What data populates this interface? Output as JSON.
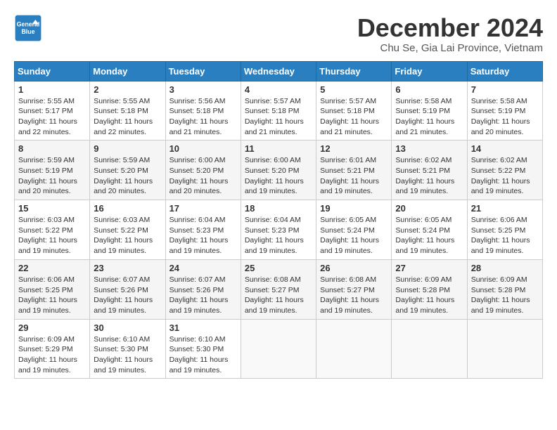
{
  "logo": {
    "line1": "General",
    "line2": "Blue"
  },
  "title": "December 2024",
  "subtitle": "Chu Se, Gia Lai Province, Vietnam",
  "days_of_week": [
    "Sunday",
    "Monday",
    "Tuesday",
    "Wednesday",
    "Thursday",
    "Friday",
    "Saturday"
  ],
  "weeks": [
    [
      {
        "num": "1",
        "sunrise": "5:55 AM",
        "sunset": "5:17 PM",
        "daylight": "11 hours and 22 minutes."
      },
      {
        "num": "2",
        "sunrise": "5:55 AM",
        "sunset": "5:18 PM",
        "daylight": "11 hours and 22 minutes."
      },
      {
        "num": "3",
        "sunrise": "5:56 AM",
        "sunset": "5:18 PM",
        "daylight": "11 hours and 21 minutes."
      },
      {
        "num": "4",
        "sunrise": "5:57 AM",
        "sunset": "5:18 PM",
        "daylight": "11 hours and 21 minutes."
      },
      {
        "num": "5",
        "sunrise": "5:57 AM",
        "sunset": "5:18 PM",
        "daylight": "11 hours and 21 minutes."
      },
      {
        "num": "6",
        "sunrise": "5:58 AM",
        "sunset": "5:19 PM",
        "daylight": "11 hours and 21 minutes."
      },
      {
        "num": "7",
        "sunrise": "5:58 AM",
        "sunset": "5:19 PM",
        "daylight": "11 hours and 20 minutes."
      }
    ],
    [
      {
        "num": "8",
        "sunrise": "5:59 AM",
        "sunset": "5:19 PM",
        "daylight": "11 hours and 20 minutes."
      },
      {
        "num": "9",
        "sunrise": "5:59 AM",
        "sunset": "5:20 PM",
        "daylight": "11 hours and 20 minutes."
      },
      {
        "num": "10",
        "sunrise": "6:00 AM",
        "sunset": "5:20 PM",
        "daylight": "11 hours and 20 minutes."
      },
      {
        "num": "11",
        "sunrise": "6:00 AM",
        "sunset": "5:20 PM",
        "daylight": "11 hours and 19 minutes."
      },
      {
        "num": "12",
        "sunrise": "6:01 AM",
        "sunset": "5:21 PM",
        "daylight": "11 hours and 19 minutes."
      },
      {
        "num": "13",
        "sunrise": "6:02 AM",
        "sunset": "5:21 PM",
        "daylight": "11 hours and 19 minutes."
      },
      {
        "num": "14",
        "sunrise": "6:02 AM",
        "sunset": "5:22 PM",
        "daylight": "11 hours and 19 minutes."
      }
    ],
    [
      {
        "num": "15",
        "sunrise": "6:03 AM",
        "sunset": "5:22 PM",
        "daylight": "11 hours and 19 minutes."
      },
      {
        "num": "16",
        "sunrise": "6:03 AM",
        "sunset": "5:22 PM",
        "daylight": "11 hours and 19 minutes."
      },
      {
        "num": "17",
        "sunrise": "6:04 AM",
        "sunset": "5:23 PM",
        "daylight": "11 hours and 19 minutes."
      },
      {
        "num": "18",
        "sunrise": "6:04 AM",
        "sunset": "5:23 PM",
        "daylight": "11 hours and 19 minutes."
      },
      {
        "num": "19",
        "sunrise": "6:05 AM",
        "sunset": "5:24 PM",
        "daylight": "11 hours and 19 minutes."
      },
      {
        "num": "20",
        "sunrise": "6:05 AM",
        "sunset": "5:24 PM",
        "daylight": "11 hours and 19 minutes."
      },
      {
        "num": "21",
        "sunrise": "6:06 AM",
        "sunset": "5:25 PM",
        "daylight": "11 hours and 19 minutes."
      }
    ],
    [
      {
        "num": "22",
        "sunrise": "6:06 AM",
        "sunset": "5:25 PM",
        "daylight": "11 hours and 19 minutes."
      },
      {
        "num": "23",
        "sunrise": "6:07 AM",
        "sunset": "5:26 PM",
        "daylight": "11 hours and 19 minutes."
      },
      {
        "num": "24",
        "sunrise": "6:07 AM",
        "sunset": "5:26 PM",
        "daylight": "11 hours and 19 minutes."
      },
      {
        "num": "25",
        "sunrise": "6:08 AM",
        "sunset": "5:27 PM",
        "daylight": "11 hours and 19 minutes."
      },
      {
        "num": "26",
        "sunrise": "6:08 AM",
        "sunset": "5:27 PM",
        "daylight": "11 hours and 19 minutes."
      },
      {
        "num": "27",
        "sunrise": "6:09 AM",
        "sunset": "5:28 PM",
        "daylight": "11 hours and 19 minutes."
      },
      {
        "num": "28",
        "sunrise": "6:09 AM",
        "sunset": "5:28 PM",
        "daylight": "11 hours and 19 minutes."
      }
    ],
    [
      {
        "num": "29",
        "sunrise": "6:09 AM",
        "sunset": "5:29 PM",
        "daylight": "11 hours and 19 minutes."
      },
      {
        "num": "30",
        "sunrise": "6:10 AM",
        "sunset": "5:30 PM",
        "daylight": "11 hours and 19 minutes."
      },
      {
        "num": "31",
        "sunrise": "6:10 AM",
        "sunset": "5:30 PM",
        "daylight": "11 hours and 19 minutes."
      },
      null,
      null,
      null,
      null
    ]
  ]
}
